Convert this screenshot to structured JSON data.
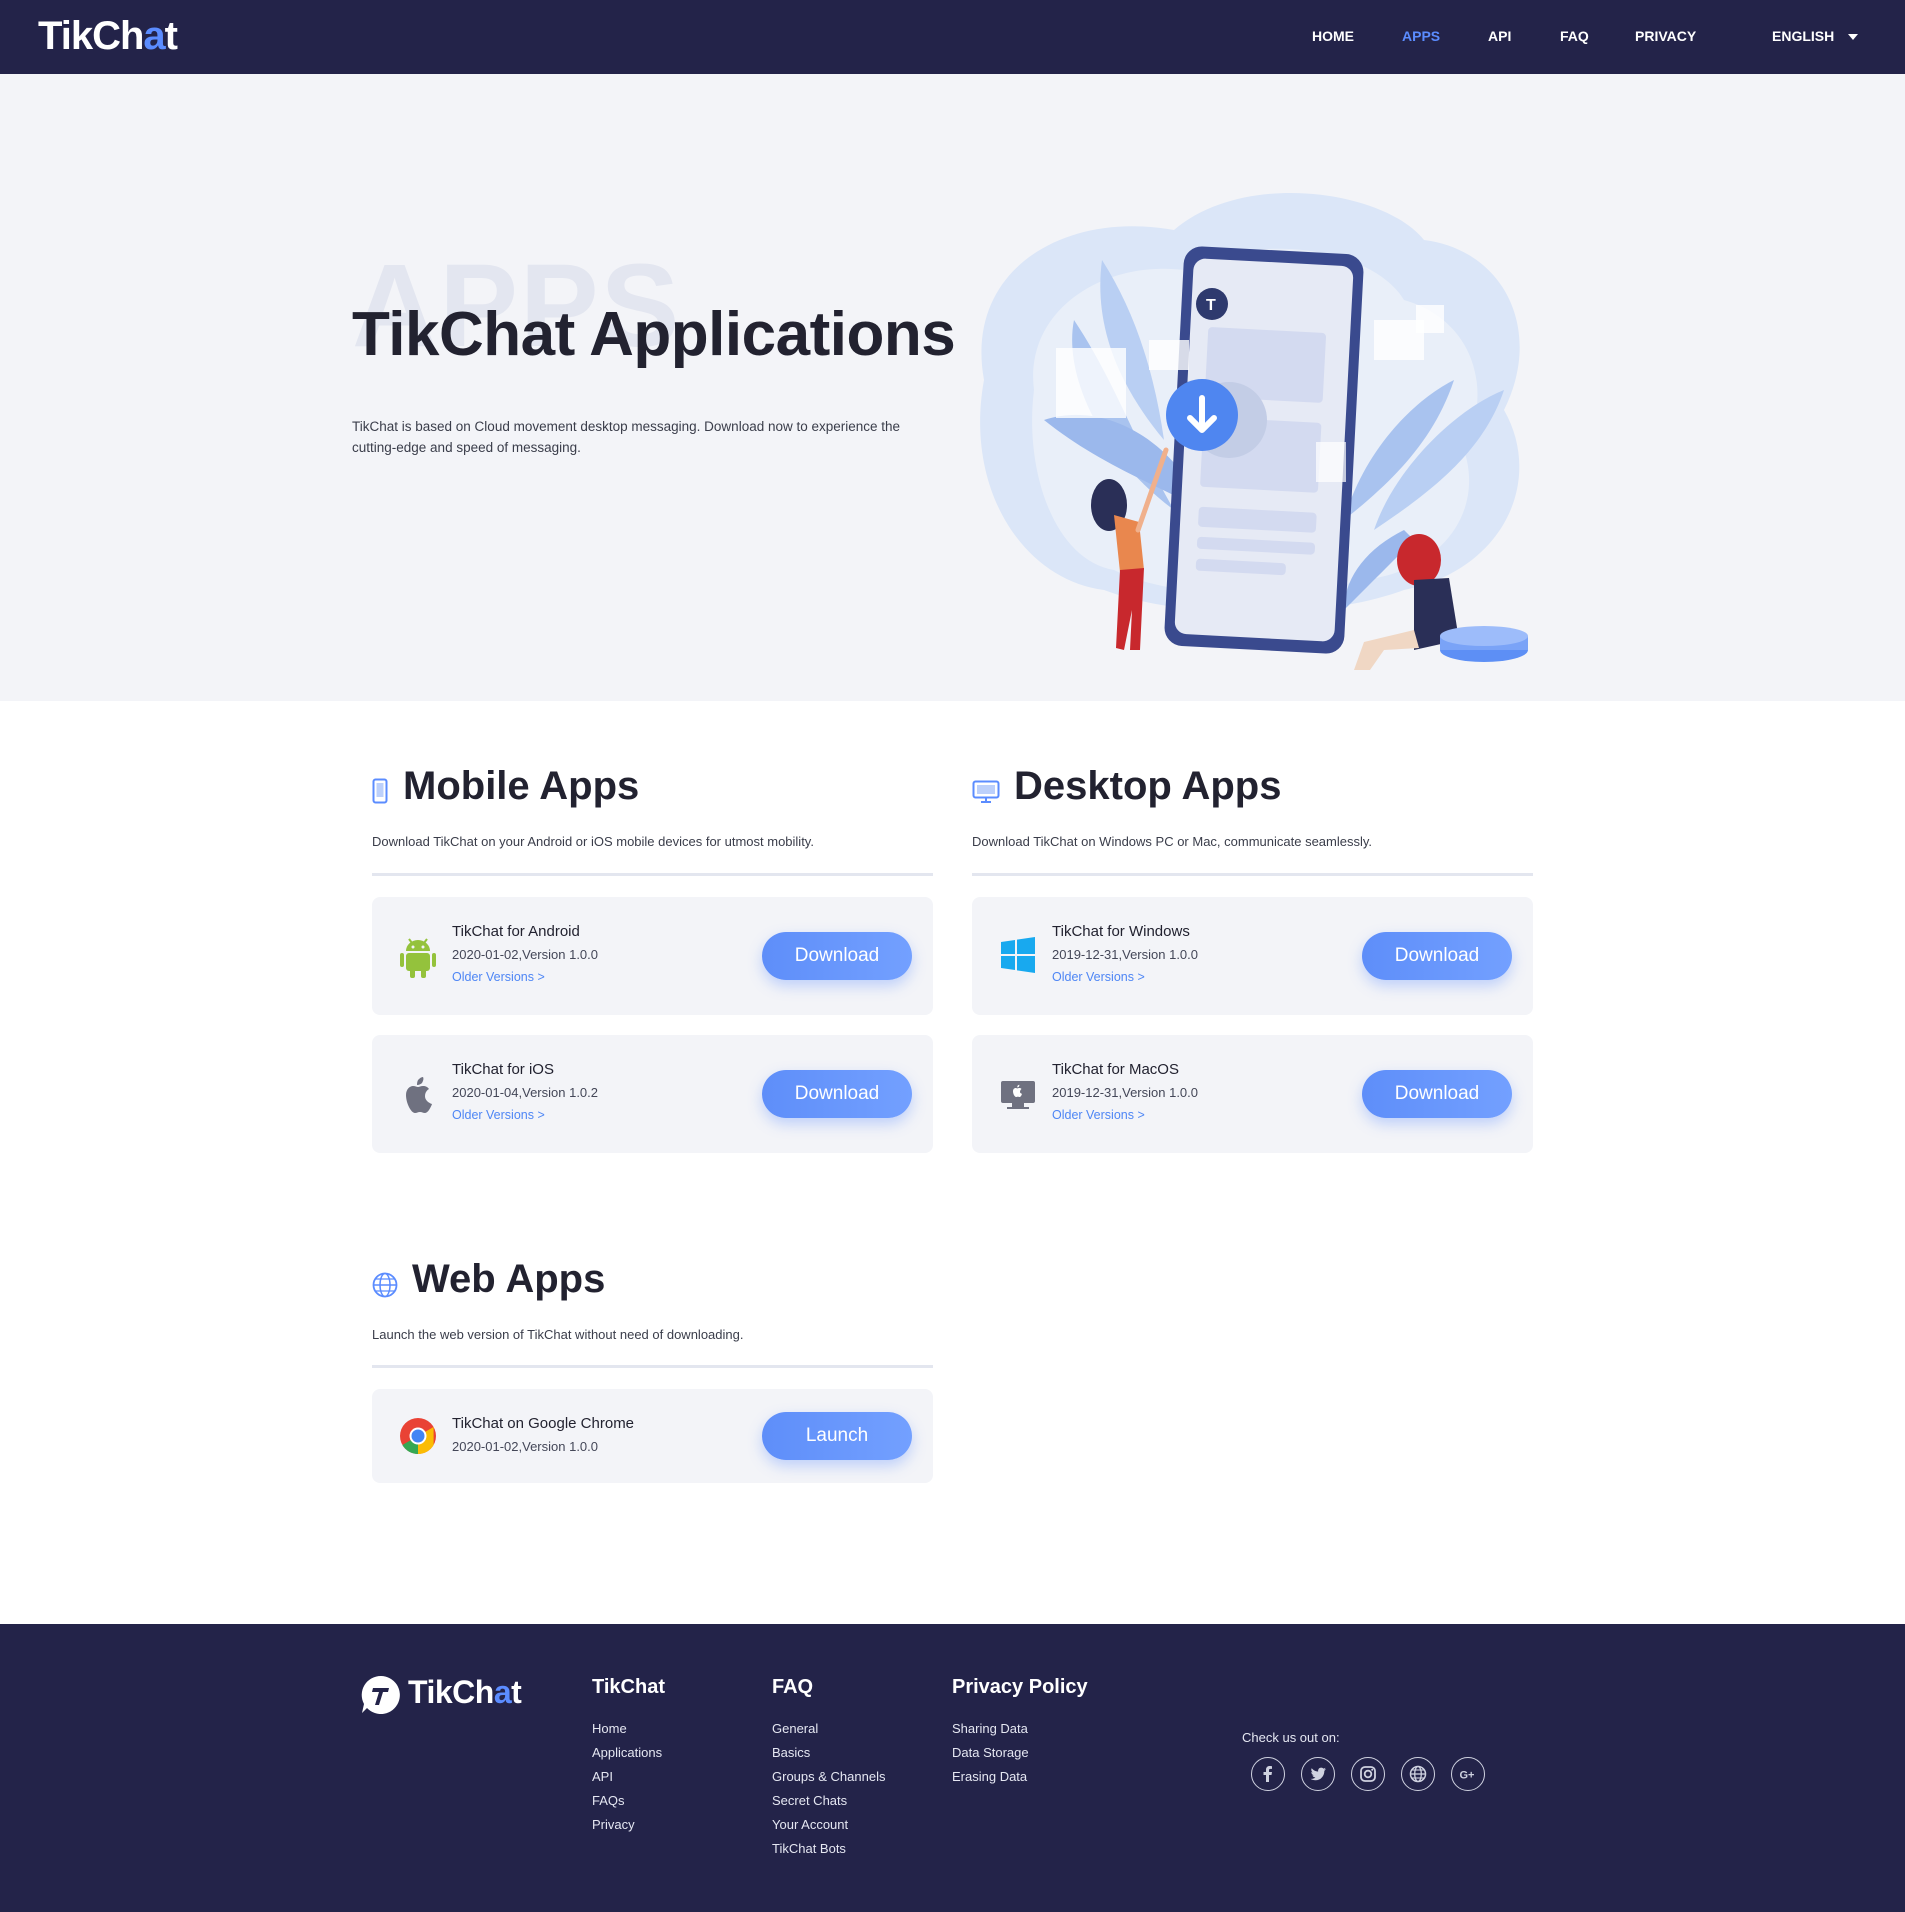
{
  "nav": {
    "brand_main": "TikCh",
    "brand_accent": "a",
    "brand_tail": "t",
    "links": [
      {
        "label": "HOME",
        "active": false
      },
      {
        "label": "APPS",
        "active": true
      },
      {
        "label": "API",
        "active": false
      },
      {
        "label": "FAQ",
        "active": false
      },
      {
        "label": "PRIVACY",
        "active": false
      }
    ],
    "language": "ENGLISH"
  },
  "hero": {
    "watermark": "APPS",
    "title": "TikChat Applications",
    "description": "TikChat is based on Cloud movement desktop messaging. Download now to experience the cutting-edge and speed of messaging."
  },
  "sections": {
    "mobile": {
      "title": "Mobile Apps",
      "description": "Download TikChat on your Android or iOS mobile devices for utmost mobility.",
      "cards": [
        {
          "name": "TikChat for Android",
          "meta": "2020-01-02,Version 1.0.0",
          "older": "Older Versions >",
          "button": "Download",
          "icon": "android-icon"
        },
        {
          "name": "TikChat for iOS",
          "meta": "2020-01-04,Version 1.0.2",
          "older": "Older Versions >",
          "button": "Download",
          "icon": "apple-icon"
        }
      ]
    },
    "desktop": {
      "title": "Desktop Apps",
      "description": "Download TikChat on Windows PC or Mac, communicate seamlessly.",
      "cards": [
        {
          "name": "TikChat for Windows",
          "meta": "2019-12-31,Version 1.0.0",
          "older": "Older Versions >",
          "button": "Download",
          "icon": "windows-icon"
        },
        {
          "name": "TikChat for MacOS",
          "meta": "2019-12-31,Version 1.0.0",
          "older": "Older Versions >",
          "button": "Download",
          "icon": "mac-icon"
        }
      ]
    },
    "web": {
      "title": "Web Apps",
      "description": "Launch the web version of TikChat without need of downloading.",
      "cards": [
        {
          "name": "TikChat on Google Chrome",
          "meta": "2020-01-02,Version 1.0.0",
          "button": "Launch",
          "icon": "chrome-icon"
        }
      ]
    }
  },
  "footer": {
    "logo_main": "TikCh",
    "logo_accent": "a",
    "logo_tail": "t",
    "columns": [
      {
        "title": "TikChat",
        "links": [
          "Home",
          "Applications",
          "API",
          "FAQs",
          "Privacy"
        ]
      },
      {
        "title": "FAQ",
        "links": [
          "General",
          "Basics",
          "Groups & Channels",
          "Secret Chats",
          "Your Account",
          "TikChat Bots"
        ]
      },
      {
        "title": "Privacy Policy",
        "links": [
          "Sharing Data",
          "Data Storage",
          "Erasing Data"
        ]
      }
    ],
    "social_label": "Check us out on:",
    "social_icons": [
      "facebook-icon",
      "twitter-icon",
      "instagram-icon",
      "globe-icon",
      "google-plus-icon"
    ]
  },
  "colors": {
    "nav_bg": "#232349",
    "accent": "#5b8cff",
    "hero_bg": "#f3f4f8",
    "card_bg": "#f3f4f8"
  }
}
